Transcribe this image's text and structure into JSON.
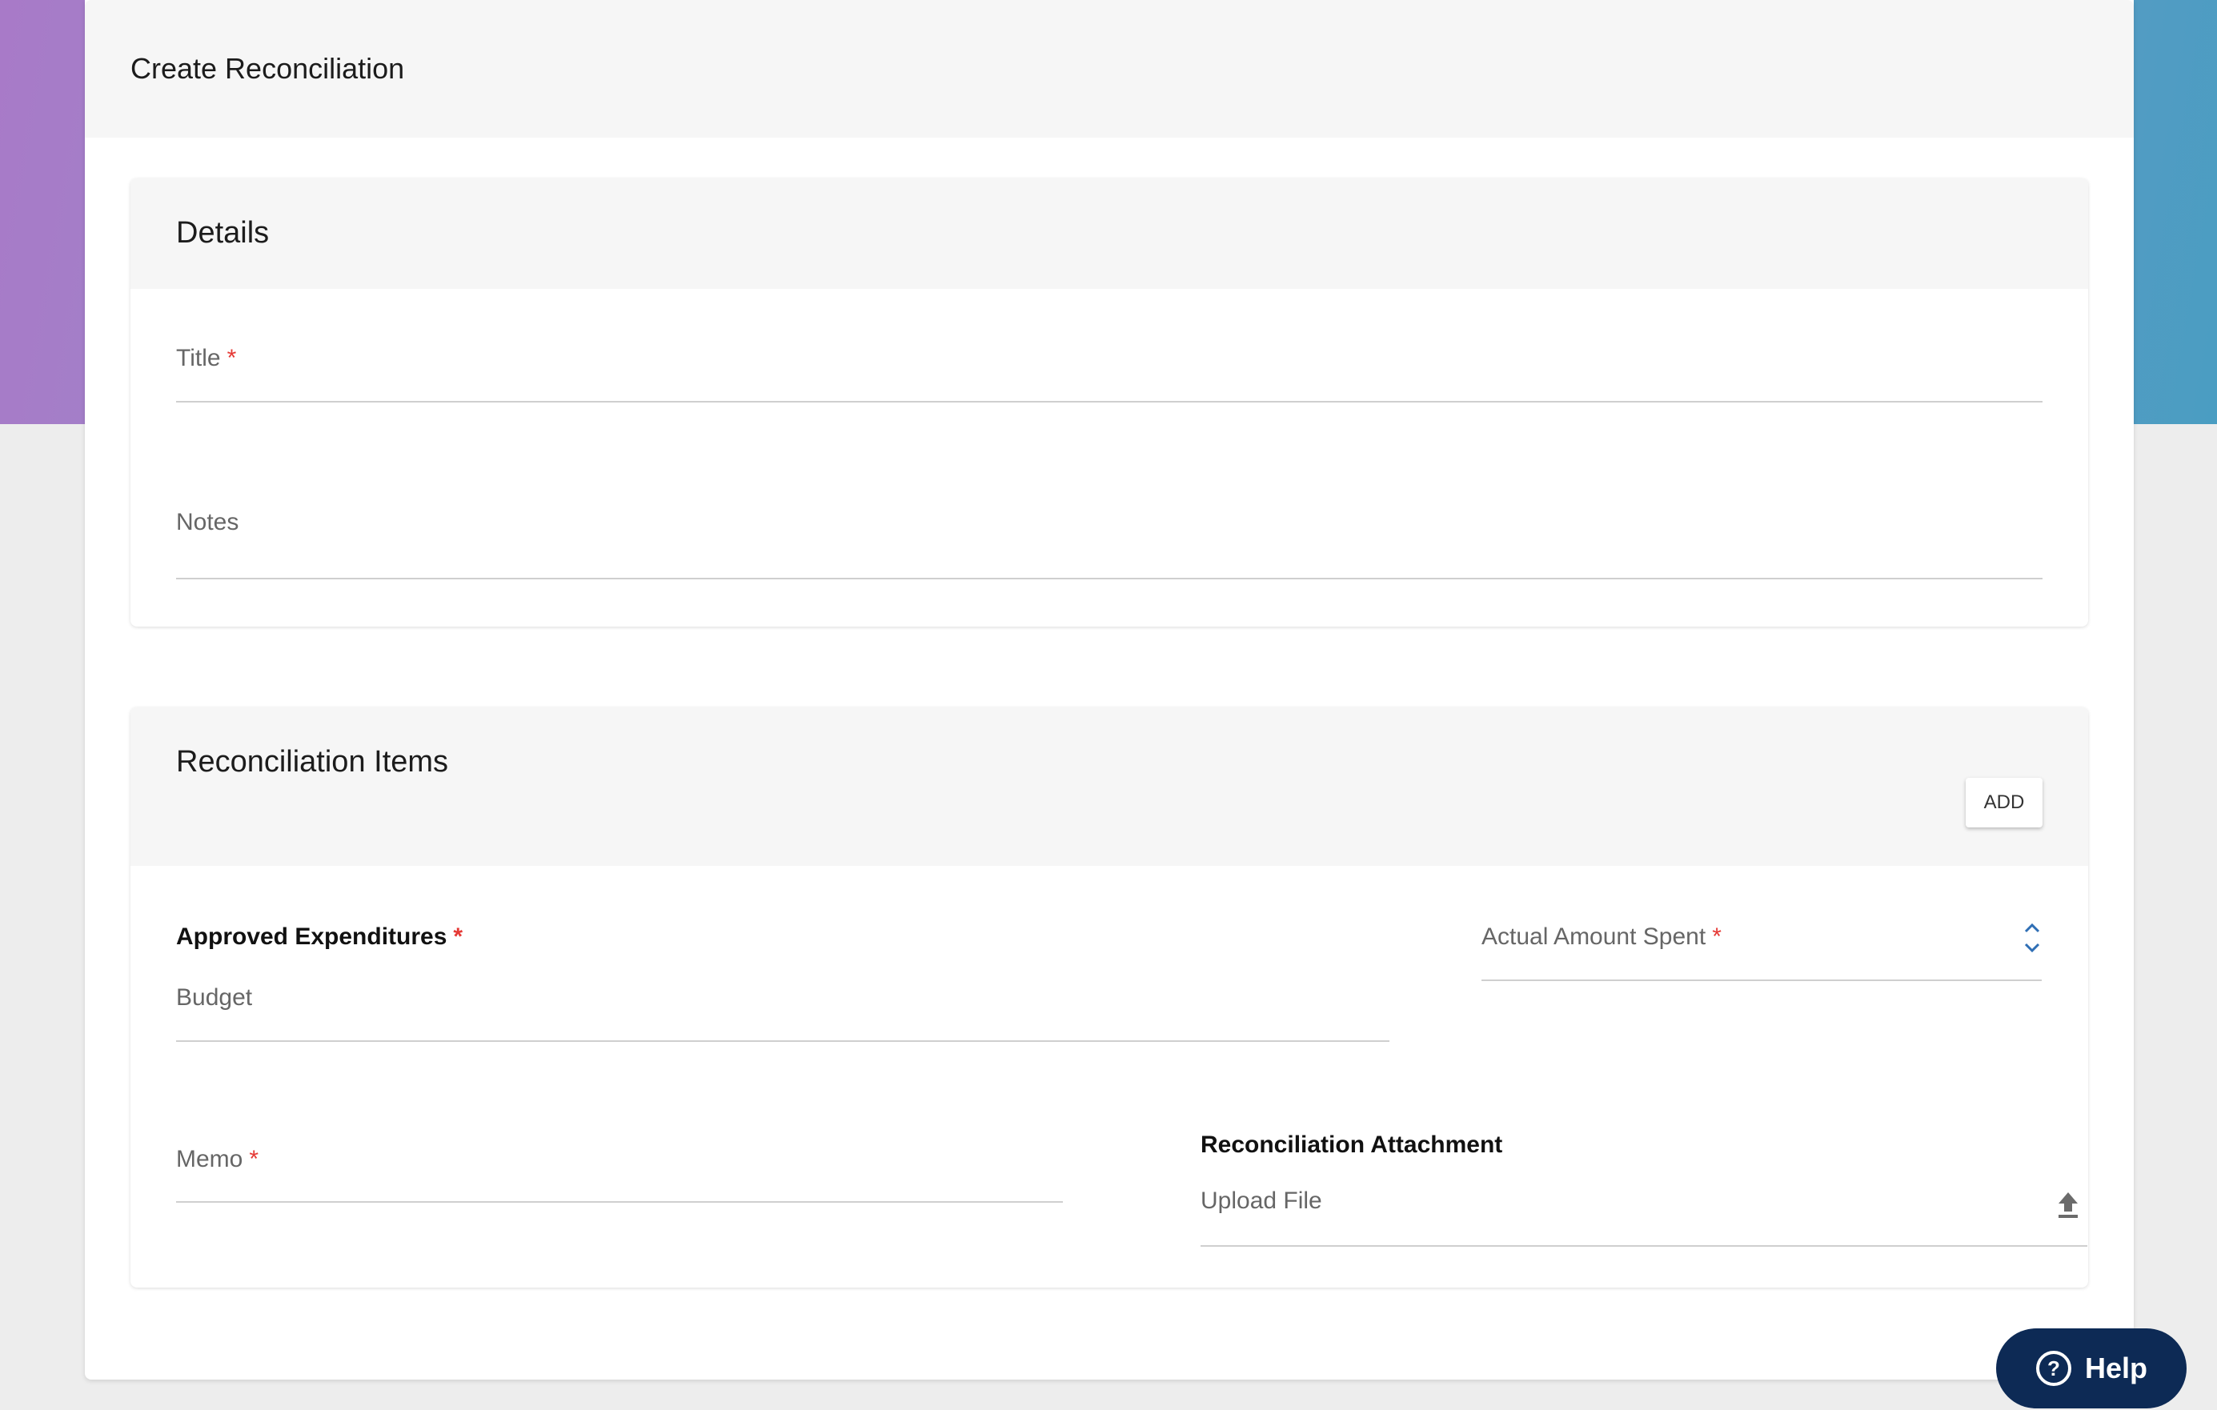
{
  "page": {
    "title": "Create Reconciliation"
  },
  "details": {
    "heading": "Details",
    "title_label": "Title",
    "required_mark": "*",
    "notes_label": "Notes"
  },
  "items": {
    "heading": "Reconciliation Items",
    "add_label": "ADD",
    "approved_label": "Approved Expenditures",
    "budget_value": "Budget",
    "actual_label": "Actual Amount Spent",
    "memo_label": "Memo",
    "attachment_label": "Reconciliation Attachment",
    "upload_placeholder": "Upload File"
  },
  "help": {
    "label": "Help"
  },
  "icons": {
    "spinner": "spinner-icon",
    "upload": "upload-icon",
    "help": "question-circle-icon"
  },
  "colors": {
    "required": "#e53935",
    "help_bg": "#0d2a55",
    "spinner": "#2f6fb5"
  }
}
